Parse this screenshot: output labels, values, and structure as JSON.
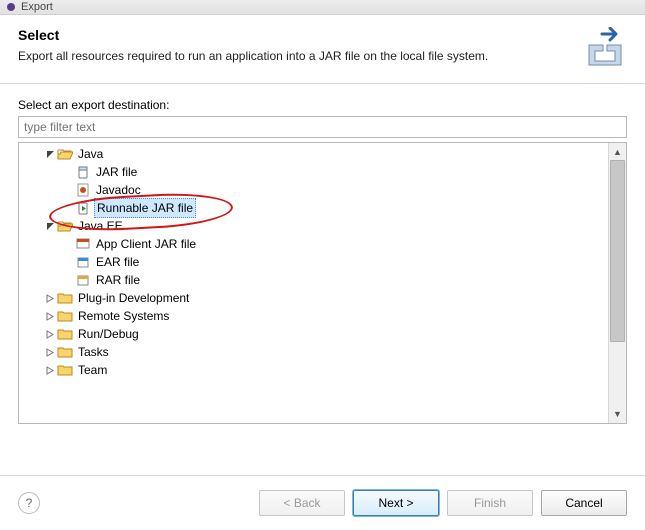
{
  "window": {
    "title": "Export"
  },
  "header": {
    "title": "Select",
    "description": "Export all resources required to run an application into a JAR file on the local file system."
  },
  "body": {
    "destination_label": "Select an export destination:",
    "filter_placeholder": "type filter text"
  },
  "tree": {
    "items": [
      {
        "level": 1,
        "expander": "expanded",
        "icon": "folder-open",
        "label": "Java",
        "selected": false
      },
      {
        "level": 2,
        "expander": "none",
        "icon": "jar",
        "label": "JAR file",
        "selected": false
      },
      {
        "level": 2,
        "expander": "none",
        "icon": "javadoc",
        "label": "Javadoc",
        "selected": false
      },
      {
        "level": 2,
        "expander": "none",
        "icon": "runnable-jar",
        "label": "Runnable JAR file",
        "selected": true
      },
      {
        "level": 1,
        "expander": "expanded",
        "icon": "folder-open",
        "label": "Java EE",
        "selected": false
      },
      {
        "level": 2,
        "expander": "none",
        "icon": "app-client",
        "label": "App Client JAR file",
        "selected": false
      },
      {
        "level": 2,
        "expander": "none",
        "icon": "ear",
        "label": "EAR file",
        "selected": false
      },
      {
        "level": 2,
        "expander": "none",
        "icon": "rar",
        "label": "RAR file",
        "selected": false
      },
      {
        "level": 1,
        "expander": "collapsed",
        "icon": "folder",
        "label": "Plug-in Development",
        "selected": false
      },
      {
        "level": 1,
        "expander": "collapsed",
        "icon": "folder",
        "label": "Remote Systems",
        "selected": false
      },
      {
        "level": 1,
        "expander": "collapsed",
        "icon": "folder",
        "label": "Run/Debug",
        "selected": false
      },
      {
        "level": 1,
        "expander": "collapsed",
        "icon": "folder",
        "label": "Tasks",
        "selected": false
      },
      {
        "level": 1,
        "expander": "collapsed",
        "icon": "folder",
        "label": "Team",
        "selected": false
      }
    ]
  },
  "buttons": {
    "back": "< Back",
    "next": "Next >",
    "finish": "Finish",
    "cancel": "Cancel"
  },
  "colors": {
    "selection": "#cde8ff",
    "annotation": "#d01616",
    "accent": "#3c7fb1"
  }
}
